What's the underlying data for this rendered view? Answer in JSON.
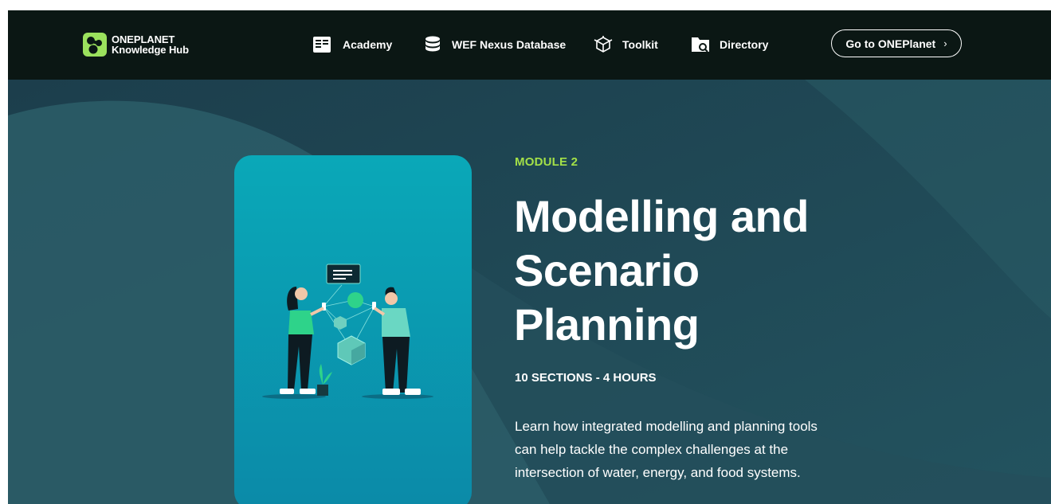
{
  "brand": {
    "line1": "ONEPLANET",
    "line2": "Knowledge Hub",
    "accent": "#9be15d"
  },
  "nav": {
    "items": [
      {
        "label": "Academy",
        "icon": "document-icon"
      },
      {
        "label": "WEF Nexus Database",
        "icon": "database-icon"
      },
      {
        "label": "Toolkit",
        "icon": "cube-icon"
      },
      {
        "label": "Directory",
        "icon": "folder-search-icon"
      }
    ],
    "cta_label": "Go to ONEPlanet",
    "cta_icon": "chevron-right-icon"
  },
  "hero": {
    "module_label": "MODULE 2",
    "title_lines": [
      "Modelling and",
      "Scenario",
      "Planning"
    ],
    "meta": "10 SECTIONS - 4 HOURS",
    "description": "Learn how integrated modelling and planning tools can help tackle the complex challenges at the intersection of water, energy, and food systems.",
    "illustration": "two-people-with-phones-and-data-shapes"
  },
  "colors": {
    "nav_bg": "#0b1714",
    "hero_bg": "#1f4d5a",
    "module_label": "#a3e048",
    "card": "#0aa8b8"
  }
}
